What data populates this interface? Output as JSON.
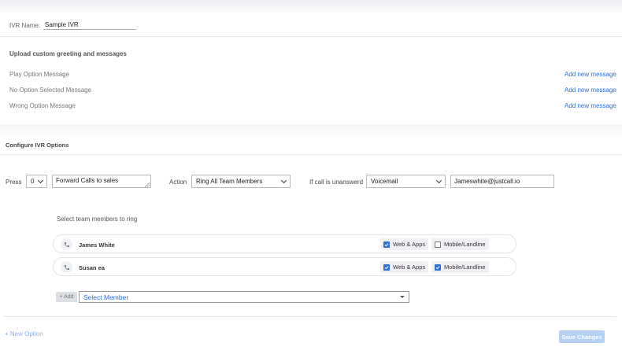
{
  "ivr": {
    "name_label": "IVR Name:",
    "name_value": "Sample IVR"
  },
  "upload": {
    "heading": "Upload custom greeting and messages",
    "messages": [
      {
        "label": "Play Option Message",
        "link": "Add new message"
      },
      {
        "label": "No Option Selected Message",
        "link": "Add new message"
      },
      {
        "label": "Wrong Option Message",
        "link": "Add new message"
      }
    ]
  },
  "configure": {
    "heading": "Configure IVR Options",
    "press_label": "Press",
    "press_value": "0",
    "description_value": "Forward Calls to sales",
    "action_label": "Action",
    "action_value": "Ring All Team Members",
    "unanswered_label": "If call is unanswerd",
    "unanswered_value": "Voicemail",
    "email_value": "Jameswhite@justcall.io"
  },
  "members": {
    "heading": "Select team members to ring",
    "rows": [
      {
        "name": "James White",
        "web_label": "Web & Apps",
        "web_checked": true,
        "mobile_label": "Mobile/Landline",
        "mobile_checked": false
      },
      {
        "name": "Susan ea",
        "web_label": "Web & Apps",
        "web_checked": true,
        "mobile_label": "Mobile/Landline",
        "mobile_checked": true
      }
    ],
    "add_label": "+ Add",
    "select_placeholder": "Select Member"
  },
  "footer": {
    "new_option": "+ New Option",
    "save": "Save Changes"
  },
  "colors": {
    "accent": "#2b6fd6",
    "button": "#2b7de0"
  }
}
